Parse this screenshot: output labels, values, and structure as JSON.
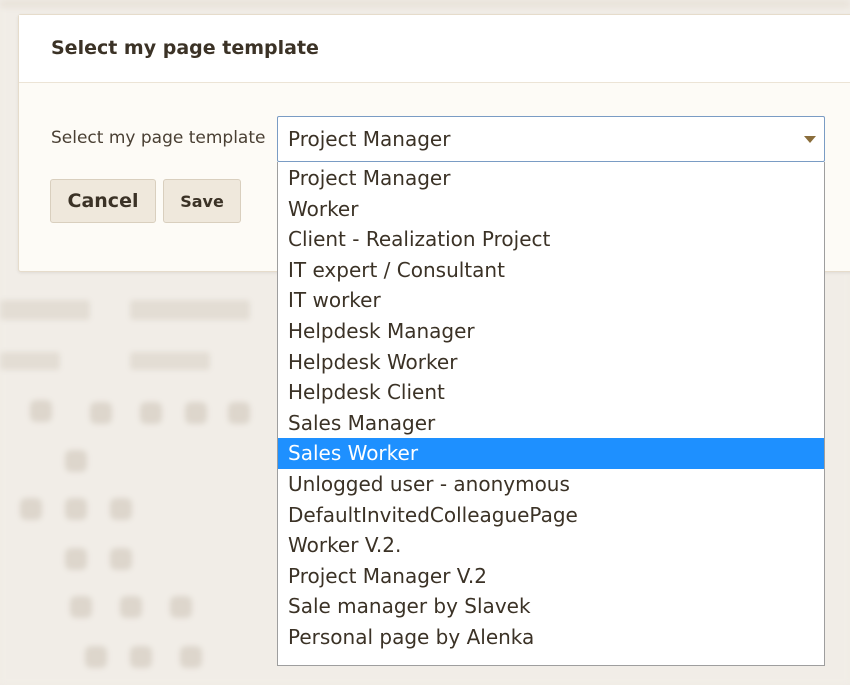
{
  "dialog": {
    "title": "Select my page template",
    "field_label": "Select my page template",
    "cancel_label": "Cancel",
    "save_label": "Save"
  },
  "select": {
    "current_value": "Project Manager",
    "highlighted_index": 9,
    "options": [
      "Project Manager",
      "Worker",
      "Client - Realization Project",
      "IT expert / Consultant",
      "IT worker",
      "Helpdesk Manager",
      "Helpdesk Worker",
      "Helpdesk Client",
      "Sales Manager",
      "Sales Worker",
      "Unlogged user - anonymous",
      "DefaultInvitedColleaguePage",
      "Worker V.2.",
      "Project Manager V.2",
      "Sale manager by Slavek",
      "Personal page by Alenka"
    ]
  },
  "colors": {
    "highlight": "#1e90ff",
    "dialog_bg": "#fdfbf6",
    "button_bg": "#efe8dc",
    "caret": "#8a6d3b"
  },
  "icons": {
    "caret": "chevron-down-icon"
  }
}
